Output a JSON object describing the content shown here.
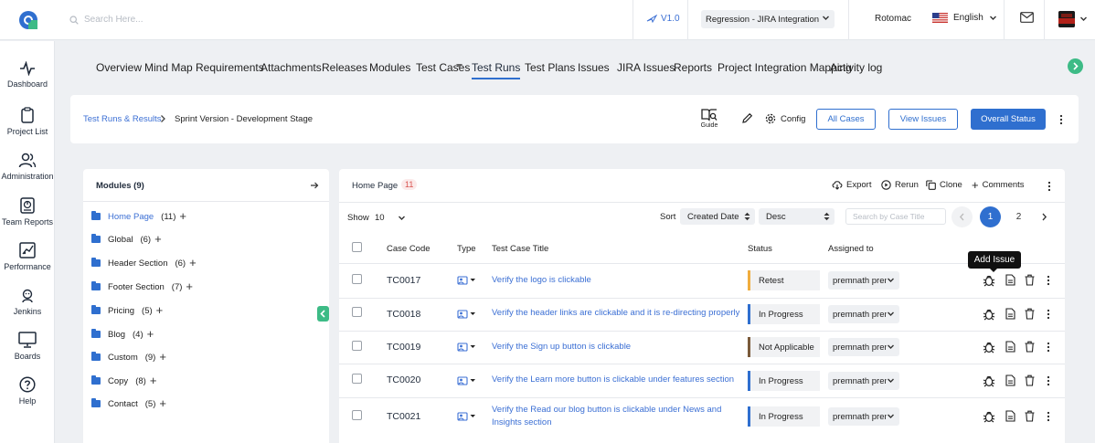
{
  "header": {
    "search_placeholder": "Search Here...",
    "version": "V1.0",
    "project": "Regression - JIRA Integration",
    "organization": "Rotomac",
    "language": "English"
  },
  "sidebar": {
    "items": [
      {
        "label": "Dashboard",
        "icon": "activity-icon"
      },
      {
        "label": "Project List",
        "icon": "clipboard-icon"
      },
      {
        "label": "Administration",
        "icon": "users-icon"
      },
      {
        "label": "Team Reports",
        "icon": "report-icon"
      },
      {
        "label": "Performance",
        "icon": "chart-icon"
      },
      {
        "label": "Jenkins",
        "icon": "jenkins-icon"
      },
      {
        "label": "Boards",
        "icon": "board-icon"
      },
      {
        "label": "Help",
        "icon": "help-icon"
      }
    ]
  },
  "nav": {
    "tabs": [
      "Overview",
      "Mind Map",
      "Requirements",
      "Attachments",
      "Releases",
      "Modules",
      "Test Cases",
      "Test Runs",
      "Test Plans",
      "Issues",
      "JIRA Issues",
      "Reports",
      "Project Integration Mapping",
      "Activity log"
    ],
    "active": "Test Runs"
  },
  "breadcrumb": {
    "link": "Test Runs & Results",
    "current": "Sprint Version - Development Stage"
  },
  "toolbar": {
    "guide": "Guide",
    "config": "Config",
    "all_cases": "All Cases",
    "view_issues": "View Issues",
    "overall_status": "Overall Status"
  },
  "modules": {
    "title": "Modules (9)",
    "items": [
      {
        "name": "Home Page",
        "count": "(11)"
      },
      {
        "name": "Global",
        "count": "(6)"
      },
      {
        "name": "Header Section",
        "count": "(6)"
      },
      {
        "name": "Footer Section",
        "count": "(7)"
      },
      {
        "name": "Pricing",
        "count": "(5)"
      },
      {
        "name": "Blog",
        "count": "(4)"
      },
      {
        "name": "Custom",
        "count": "(9)"
      },
      {
        "name": "Copy",
        "count": "(8)"
      },
      {
        "name": "Contact",
        "count": "(5)"
      }
    ]
  },
  "testcases": {
    "module": "Home Page",
    "count": "11",
    "actions": {
      "export": "Export",
      "rerun": "Rerun",
      "clone": "Clone",
      "comments": "Comments"
    },
    "show_label": "Show",
    "show_value": "10",
    "sort_label": "Sort",
    "sort_field": "Created Date",
    "sort_order": "Desc",
    "search_placeholder": "Search by Case Title",
    "pages": [
      "1",
      "2"
    ],
    "columns": {
      "code": "Case Code",
      "type": "Type",
      "title": "Test Case Title",
      "status": "Status",
      "assigned": "Assigned to"
    },
    "tooltip": "Add Issue",
    "status_colors": {
      "Retest": "#f0ad3e",
      "In Progress": "#2f6fcf",
      "Not Applicable": "#7a5a3a"
    },
    "rows": [
      {
        "code": "TC0017",
        "title": "Verify the logo is clickable",
        "status": "Retest",
        "assigned": "premnath prem"
      },
      {
        "code": "TC0018",
        "title": "Verify the header links are clickable and it is re-directing properly",
        "status": "In Progress",
        "assigned": "premnath prem"
      },
      {
        "code": "TC0019",
        "title": "Verify the Sign up button is clickable",
        "status": "Not Applicable",
        "assigned": "premnath prem"
      },
      {
        "code": "TC0020",
        "title": "Verify the Learn more button is clickable under features section",
        "status": "In Progress",
        "assigned": "premnath prem"
      },
      {
        "code": "TC0021",
        "title": "Verify the Read our blog button is clickable under News and Insights section",
        "status": "In Progress",
        "assigned": "premnath prem"
      }
    ]
  }
}
